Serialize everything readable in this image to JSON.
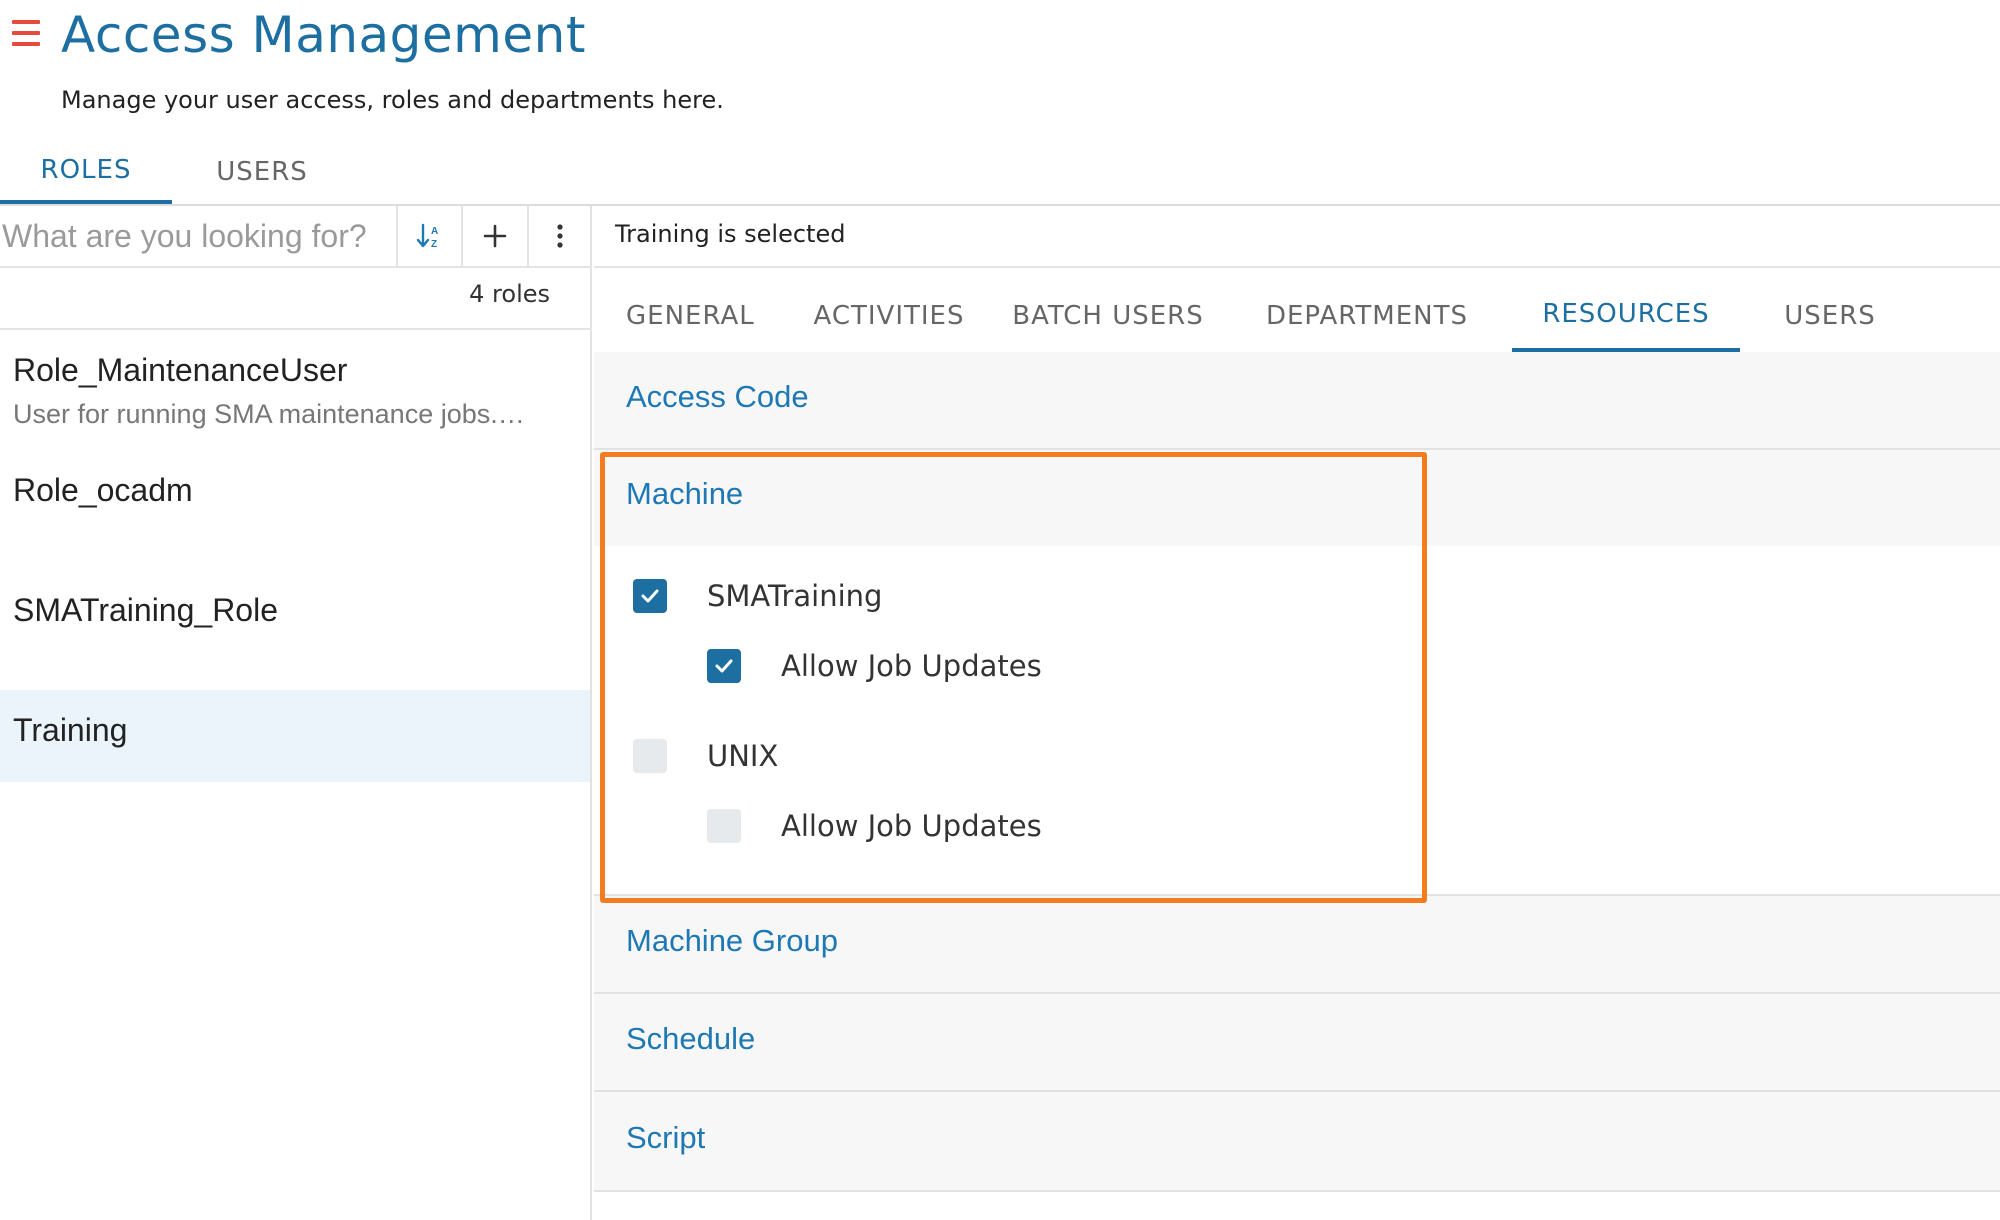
{
  "header": {
    "title": "Access Management",
    "subtitle": "Manage your user access, roles and departments here."
  },
  "main_tabs": [
    {
      "label": "ROLES",
      "active": true
    },
    {
      "label": "USERS",
      "active": false
    }
  ],
  "roles_panel": {
    "search_placeholder": "What are you looking for?",
    "toolbar_icons": [
      "sort-az-icon",
      "plus-icon",
      "more-vertical-icon"
    ],
    "count_label": "4 roles",
    "roles": [
      {
        "name": "Role_MaintenanceUser",
        "description": "User for running SMA maintenance jobs.…"
      },
      {
        "name": "Role_ocadm",
        "description": ""
      },
      {
        "name": "SMATraining_Role",
        "description": ""
      },
      {
        "name": "Training",
        "description": "",
        "selected": true
      }
    ]
  },
  "detail": {
    "selection_status": "Training is selected",
    "tabs": [
      {
        "label": "GENERAL",
        "active": false
      },
      {
        "label": "ACTIVITIES",
        "active": false
      },
      {
        "label": "BATCH USERS",
        "active": false
      },
      {
        "label": "DEPARTMENTS",
        "active": false
      },
      {
        "label": "RESOURCES",
        "active": true
      },
      {
        "label": "USERS",
        "active": false
      }
    ],
    "sections": {
      "access_code": "Access Code",
      "machine": "Machine",
      "machine_group": "Machine Group",
      "schedule": "Schedule",
      "script": "Script"
    },
    "machine_items": [
      {
        "label": "SMATraining",
        "checked": true,
        "option_label": "Allow Job Updates",
        "option_checked": true
      },
      {
        "label": "UNIX",
        "checked": false,
        "option_label": "Allow Job Updates",
        "option_checked": false
      }
    ]
  },
  "colors": {
    "accent": "#1d6fa1",
    "link": "#1d78b4",
    "menu_icon": "#e64a3c",
    "highlight_border": "#f47c20",
    "selected_row": "#ebf3fb"
  }
}
